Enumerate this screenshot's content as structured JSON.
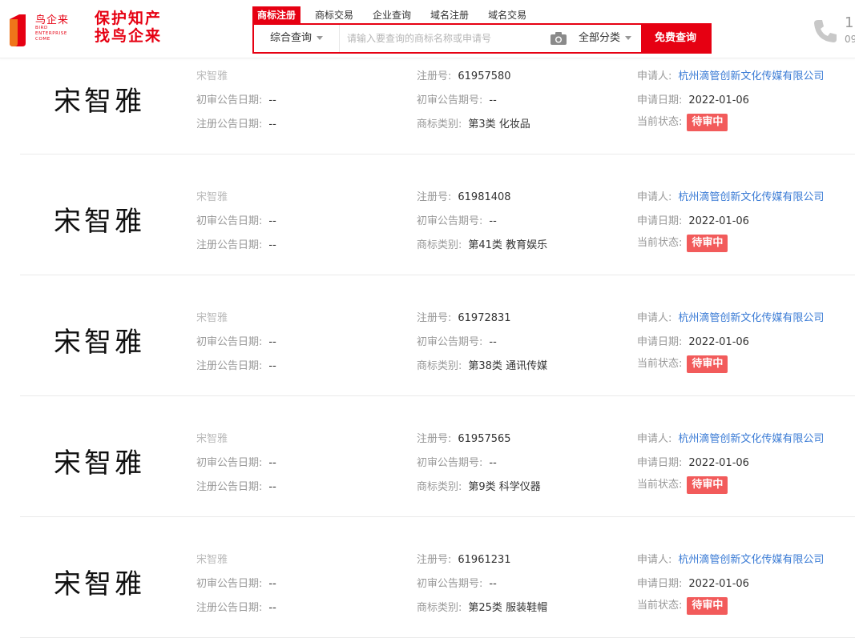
{
  "header": {
    "logo_cn": "鸟企来",
    "logo_en": "BIRD ENTERPRISE COME",
    "slogan_line1": "保护知产",
    "slogan_line2": "找鸟企来",
    "tabs": [
      "商标注册",
      "商标交易",
      "企业查询",
      "域名注册",
      "域名交易"
    ],
    "search_type": "综合查询",
    "search_placeholder": "请输入要查询的商标名称或申请号",
    "category": "全部分类",
    "search_button": "免费查询",
    "phone_line1": "1",
    "phone_line2": "09"
  },
  "labels": {
    "first_trial_date": "初审公告日期:",
    "reg_notice_date": "注册公告日期:",
    "reg_no": "注册号:",
    "first_trial_no": "初审公告期号:",
    "category": "商标类别:",
    "applicant": "申请人:",
    "apply_date": "申请日期:",
    "status": "当前状态:"
  },
  "results": [
    {
      "mark": "宋智雅",
      "name": "宋智雅",
      "first_trial_date": "--",
      "reg_notice_date": "--",
      "reg_no": "61957580",
      "first_trial_no": "--",
      "category": "第3类 化妆品",
      "applicant": "杭州滴管创新文化传媒有限公司",
      "apply_date": "2022-01-06",
      "status": "待审中"
    },
    {
      "mark": "宋智雅",
      "name": "宋智雅",
      "first_trial_date": "--",
      "reg_notice_date": "--",
      "reg_no": "61981408",
      "first_trial_no": "--",
      "category": "第41类 教育娱乐",
      "applicant": "杭州滴管创新文化传媒有限公司",
      "apply_date": "2022-01-06",
      "status": "待审中"
    },
    {
      "mark": "宋智雅",
      "name": "宋智雅",
      "first_trial_date": "--",
      "reg_notice_date": "--",
      "reg_no": "61972831",
      "first_trial_no": "--",
      "category": "第38类 通讯传媒",
      "applicant": "杭州滴管创新文化传媒有限公司",
      "apply_date": "2022-01-06",
      "status": "待审中"
    },
    {
      "mark": "宋智雅",
      "name": "宋智雅",
      "first_trial_date": "--",
      "reg_notice_date": "--",
      "reg_no": "61957565",
      "first_trial_no": "--",
      "category": "第9类 科学仪器",
      "applicant": "杭州滴管创新文化传媒有限公司",
      "apply_date": "2022-01-06",
      "status": "待审中"
    },
    {
      "mark": "宋智雅",
      "name": "宋智雅",
      "first_trial_date": "--",
      "reg_notice_date": "--",
      "reg_no": "61961231",
      "first_trial_no": "--",
      "category": "第25类 服装鞋帽",
      "applicant": "杭州滴管创新文化传媒有限公司",
      "apply_date": "2022-01-06",
      "status": "待审中"
    }
  ],
  "colors": {
    "brand": "#e60012",
    "status": "#f25b5b",
    "link": "#3a7bd5"
  }
}
